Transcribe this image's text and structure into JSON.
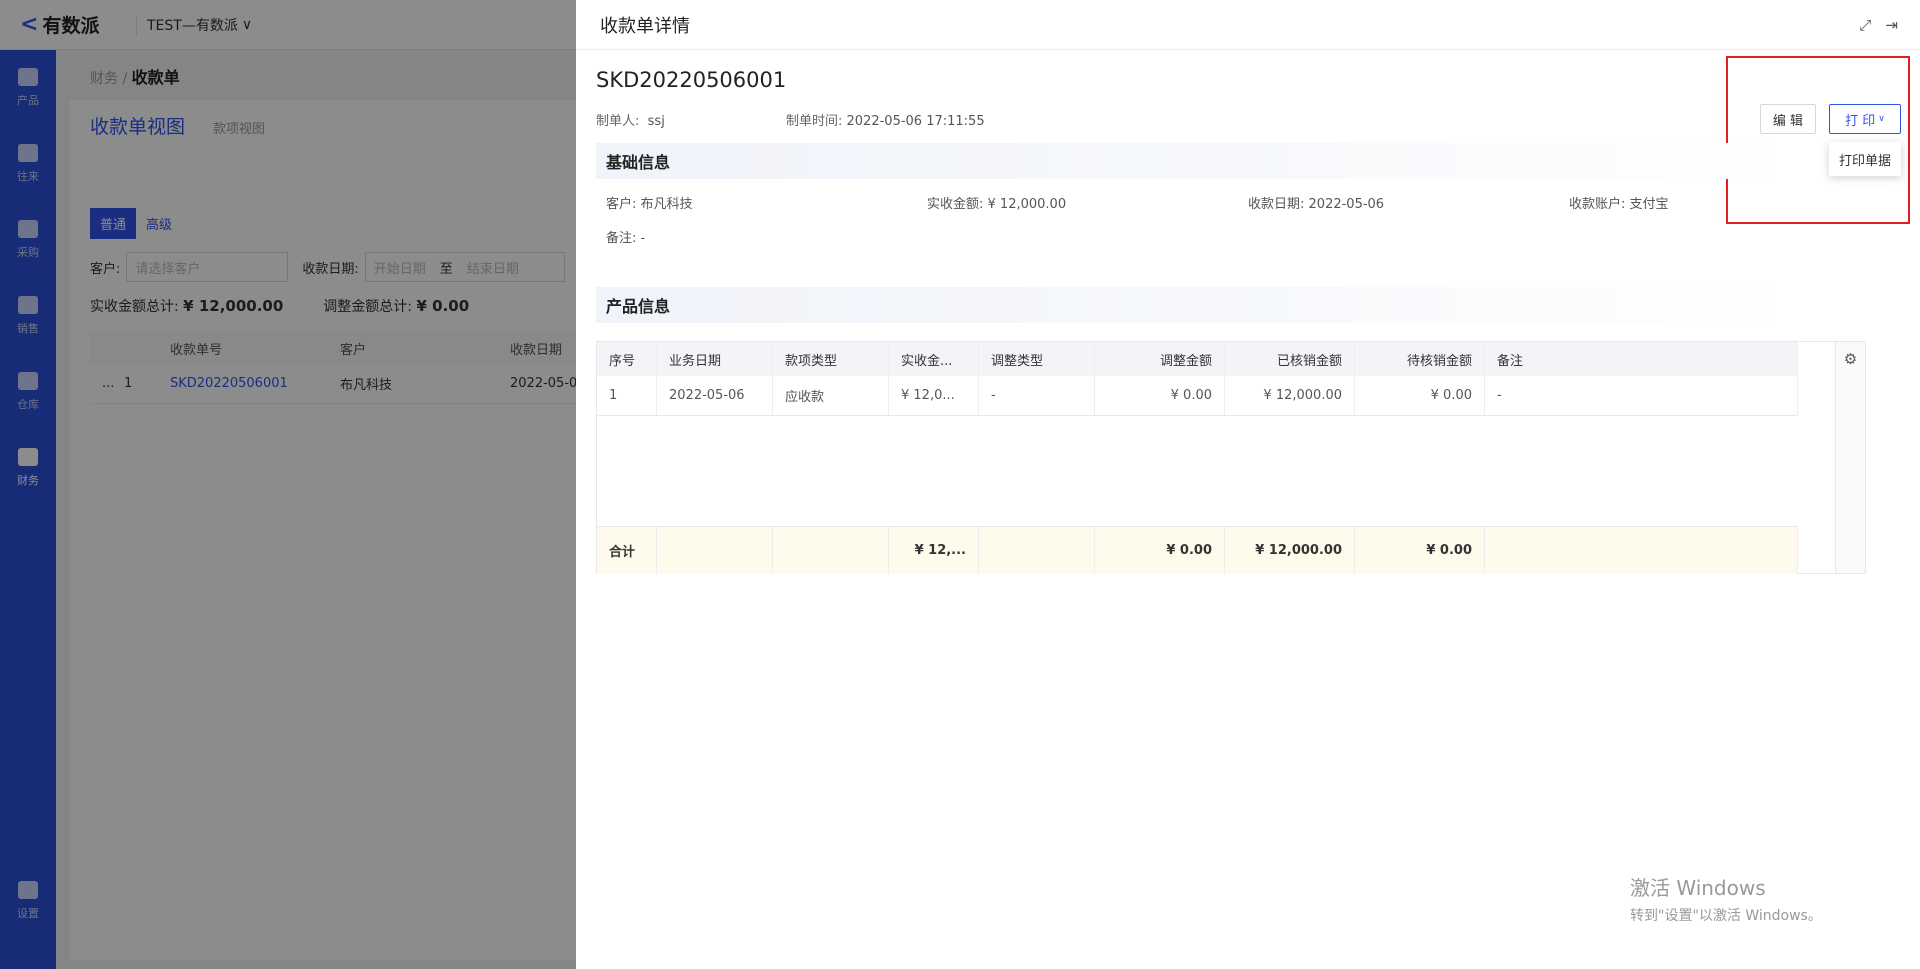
{
  "app": {
    "logo_mark": "<",
    "logo_text": "有数派",
    "tenant": "TEST—有数派",
    "tenant_chevron": "∨"
  },
  "sidebar": {
    "items": [
      {
        "label": "产品",
        "icon": "box-icon"
      },
      {
        "label": "往来",
        "icon": "contact-icon"
      },
      {
        "label": "采购",
        "icon": "cart-icon"
      },
      {
        "label": "销售",
        "icon": "clipboard-icon"
      },
      {
        "label": "仓库",
        "icon": "warehouse-icon"
      },
      {
        "label": "财务",
        "icon": "moneybag-icon"
      }
    ],
    "settings_label": "设置"
  },
  "background": {
    "breadcrumb_parent": "财务",
    "breadcrumb_sep": "/",
    "breadcrumb_current": "收款单",
    "view_tab_active": "收款单视图",
    "view_tab_other": "款项视图",
    "mode_normal": "普通",
    "mode_advanced": "高级",
    "filter_customer_label": "客户:",
    "filter_customer_placeholder": "请选择客户",
    "filter_date_label": "收款日期:",
    "filter_date_start": "开始日期",
    "filter_date_to": "至",
    "filter_date_end": "结束日期",
    "sum_actual_label": "实收金额总计:",
    "sum_actual_value": "¥ 12,000.00",
    "sum_adjust_label": "调整金额总计:",
    "sum_adjust_value": "¥ 0.00",
    "col_no": "收款单号",
    "col_customer": "客户",
    "col_date": "收款日期",
    "row_more": "...",
    "row_index": "1",
    "row_no": "SKD20220506001",
    "row_customer": "布凡科技",
    "row_date": "2022-05-0"
  },
  "drawer": {
    "title": "收款单详情",
    "doc_no": "SKD20220506001",
    "creator_label": "制单人:",
    "creator": "ssj",
    "created_label": "制单时间:",
    "created_at": "2022-05-06 17:11:55",
    "edit_label": "编 辑",
    "print_label": "打 印",
    "print_menu_item": "打印单据",
    "basic_title": "基础信息",
    "basic": {
      "customer_label": "客户:",
      "customer": "布凡科技",
      "amount_label": "实收金额:",
      "amount": "¥ 12,000.00",
      "date_label": "收款日期:",
      "date": "2022-05-06",
      "account_label": "收款账户:",
      "account": "支付宝",
      "remark_label": "备注:",
      "remark": "-"
    },
    "product_title": "产品信息",
    "table": {
      "headers": [
        "序号",
        "业务日期",
        "款项类型",
        "实收金...",
        "调整类型",
        "调整金额",
        "已核销金额",
        "待核销金额",
        "备注"
      ],
      "rows": [
        [
          "1",
          "2022-05-06",
          "应收款",
          "¥ 12,0...",
          "-",
          "¥ 0.00",
          "¥ 12,000.00",
          "¥ 0.00",
          "-"
        ]
      ],
      "footer": [
        "合计",
        "",
        "",
        "¥ 12,...",
        "",
        "¥ 0.00",
        "¥ 12,000.00",
        "¥ 0.00",
        ""
      ]
    }
  },
  "watermark": {
    "line1": "激活 Windows",
    "line2": "转到\"设置\"以激活 Windows。"
  }
}
